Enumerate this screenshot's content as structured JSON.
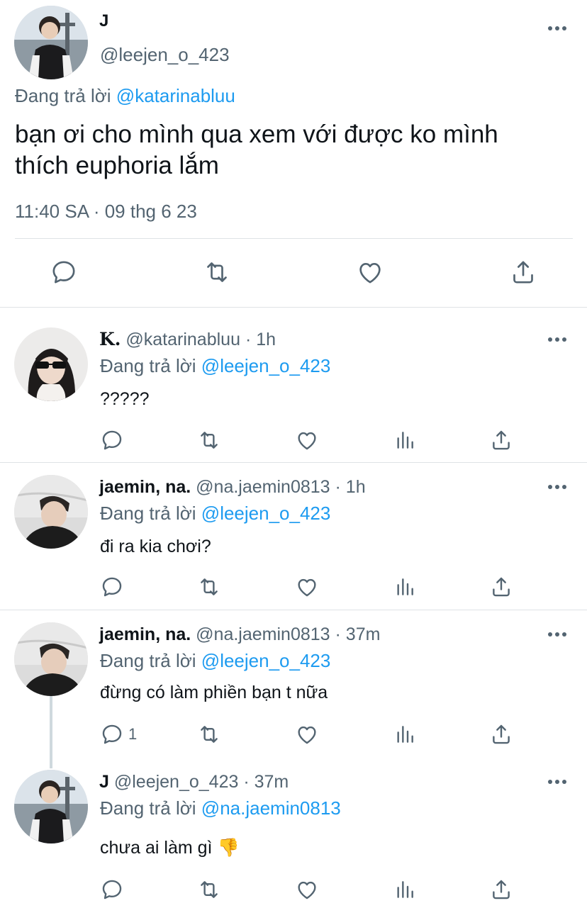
{
  "main_tweet": {
    "display_name": "J",
    "handle": "@leejen_o_423",
    "reply_label": "Đang trả lời",
    "reply_to": "@katarinabluu",
    "text_line1": "bạn ơi cho mình qua xem với được ko mình",
    "text_line2": "thích euphoria lắm",
    "timestamp": "11:40 SA · 09 thg 6 23",
    "actions": [
      "reply-icon",
      "retweet-icon",
      "like-icon",
      "share-icon"
    ]
  },
  "replies": [
    {
      "display_name": "K.",
      "handle": "@katarinabluu",
      "time": "· 1h",
      "reply_label": "Đang trả lời",
      "reply_to": "@leejen_o_423",
      "text": "?????",
      "reply_count": ""
    },
    {
      "display_name": "jaemin, na.",
      "handle": "@na.jaemin0813",
      "time": "· 1h",
      "reply_label": "Đang trả lời",
      "reply_to": "@leejen_o_423",
      "text": "đi ra kia chơi?",
      "reply_count": ""
    },
    {
      "display_name": "jaemin, na.",
      "handle": "@na.jaemin0813",
      "time": "· 37m",
      "reply_label": "Đang trả lời",
      "reply_to": "@leejen_o_423",
      "text": "đừng có làm phiền bạn t nữa",
      "reply_count": "1"
    },
    {
      "display_name": "J",
      "handle": "@leejen_o_423",
      "time": "· 37m",
      "reply_label": "Đang trả lời",
      "reply_to": "@na.jaemin0813",
      "text": "chưa ai làm gì",
      "emoji": "👎",
      "reply_count": ""
    }
  ],
  "colors": {
    "link": "#1d9bf0",
    "muted": "#536471",
    "text": "#0f1419",
    "divider": "#dfe3e6"
  }
}
